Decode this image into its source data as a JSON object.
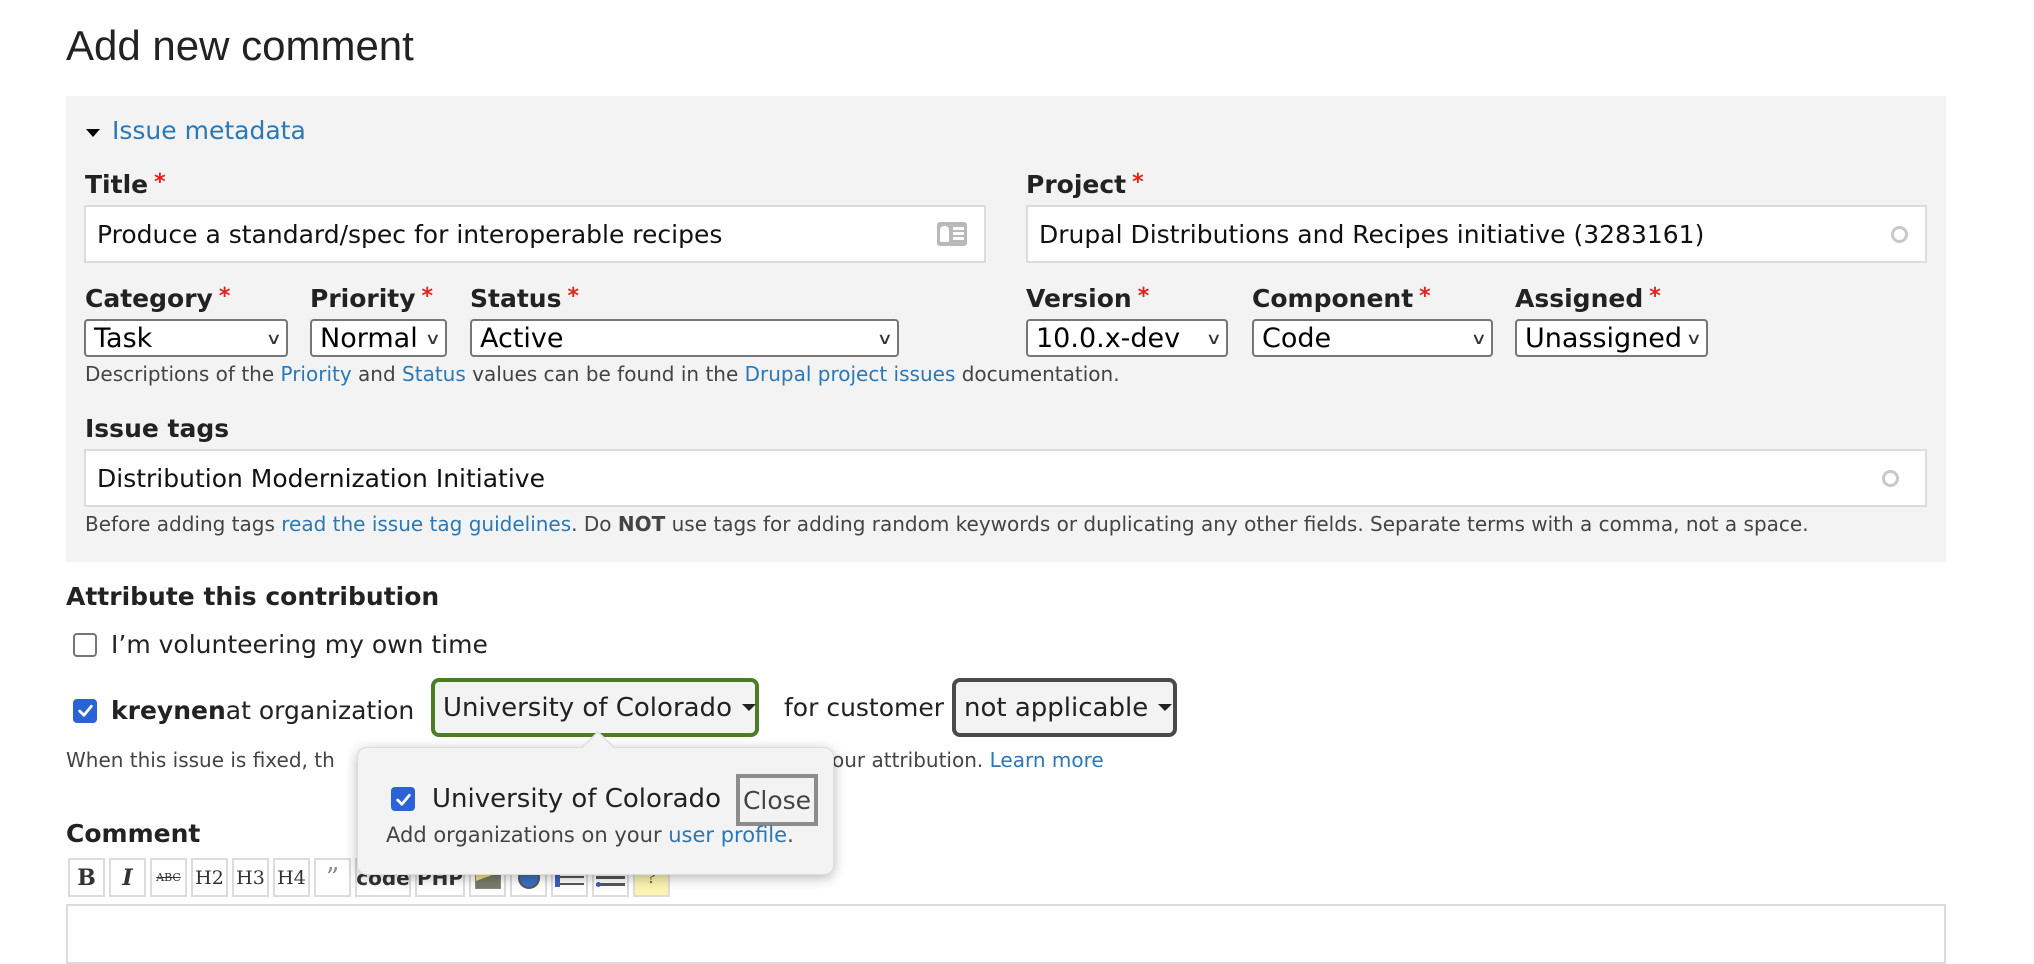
{
  "page": {
    "title": "Add new comment"
  },
  "issue_metadata": {
    "toggle_label": "Issue metadata",
    "required_marker": "*",
    "title": {
      "label": "Title",
      "value": "Produce a standard/spec for interoperable recipes",
      "icon": "contact-card-icon"
    },
    "project": {
      "label": "Project",
      "value": "Drupal Distributions and Recipes initiative  (3283161)",
      "icon": "autocomplete-throbber-icon"
    },
    "category": {
      "label": "Category",
      "value": "Task"
    },
    "priority": {
      "label": "Priority",
      "value": "Normal"
    },
    "status": {
      "label": "Status",
      "value": "Active"
    },
    "version": {
      "label": "Version",
      "value": "10.0.x-dev"
    },
    "component": {
      "label": "Component",
      "value": "Code"
    },
    "assigned": {
      "label": "Assigned",
      "value": "Unassigned"
    },
    "descriptions_help": {
      "prefix": "Descriptions of the ",
      "priority_link": "Priority",
      "and": " and ",
      "status_link": "Status",
      "middle": " values can be found in the ",
      "project_issues_link": "Drupal project issues",
      "suffix": " documentation."
    },
    "issue_tags": {
      "label": "Issue tags",
      "value": "Distribution Modernization Initiative",
      "help_prefix": "Before adding tags ",
      "help_link": "read the issue tag guidelines",
      "help_middle": ". Do ",
      "help_bold": "NOT",
      "help_suffix": " use tags for adding random keywords or duplicating any other fields. Separate terms with a comma, not a space."
    }
  },
  "attribution": {
    "heading": "Attribute this contribution",
    "volunteer": {
      "label": "I’m volunteering my own time",
      "checked": false
    },
    "user": {
      "name": "kreynen",
      "checked": true,
      "at_org_text": " at organization",
      "for_customer_text": "for customer"
    },
    "organization_value": "University of Colorado",
    "customer_value": "not applicable",
    "note_prefix": "When this issue is fixed, th",
    "note_suffix": "our attribution. ",
    "learn_more_link": "Learn more"
  },
  "org_popover": {
    "option_label": "University of Colorado",
    "option_checked": true,
    "close_label": "Close",
    "help_prefix": "Add organizations on your ",
    "help_link": "user profile",
    "help_suffix": "."
  },
  "comment": {
    "label": "Comment",
    "toolbar": [
      {
        "name": "bold-button",
        "label": "B"
      },
      {
        "name": "italic-button",
        "label": "I"
      },
      {
        "name": "strikethrough-button",
        "label": "ABC"
      },
      {
        "name": "h2-button",
        "label": "H2"
      },
      {
        "name": "h3-button",
        "label": "H3"
      },
      {
        "name": "h4-button",
        "label": "H4"
      },
      {
        "name": "quote-button",
        "label": "”"
      },
      {
        "name": "code-button",
        "label": "code"
      },
      {
        "name": "php-button",
        "label": "PHP"
      },
      {
        "name": "image-button",
        "label": "image"
      },
      {
        "name": "link-button",
        "label": "link"
      },
      {
        "name": "ordered-list-button",
        "label": "ol"
      },
      {
        "name": "unordered-list-button",
        "label": "ul"
      },
      {
        "name": "help-button",
        "label": "?"
      }
    ]
  }
}
